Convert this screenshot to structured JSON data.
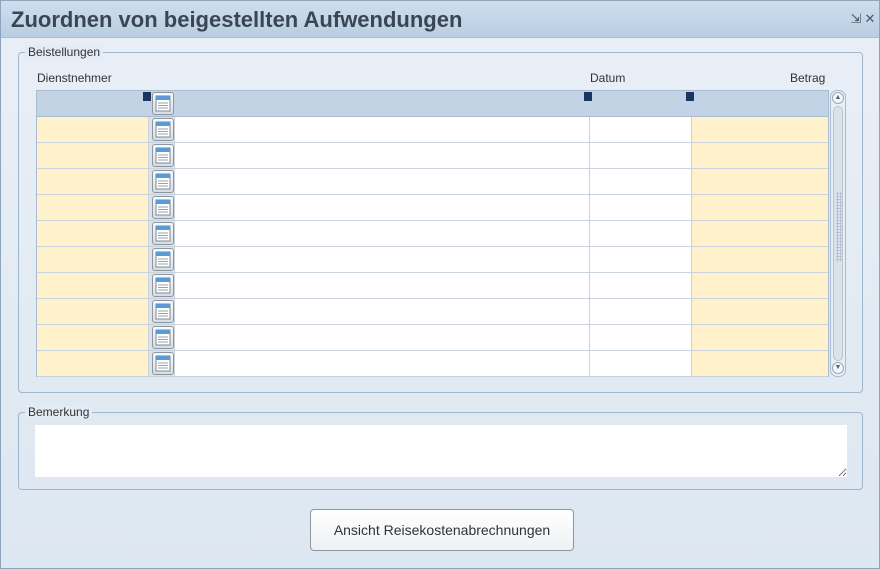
{
  "window": {
    "title": "Zuordnen von beigestellten Aufwendungen",
    "restore_glyph": "⇲",
    "close_glyph": "✕"
  },
  "beistellungen": {
    "legend": "Beistellungen",
    "columns": {
      "dienstnehmer": "Dienstnehmer",
      "datum": "Datum",
      "betrag": "Betrag"
    },
    "row_count": 10,
    "row_icon": "notepad-icon"
  },
  "bemerkung": {
    "legend": "Bemerkung",
    "value": ""
  },
  "actions": {
    "reisekosten_label": "Ansicht Reisekostenabrechnungen"
  },
  "colors": {
    "titlebar": "#b9cde2",
    "editable_cell": "#fff1cc",
    "header_row": "#c1d3e4"
  }
}
